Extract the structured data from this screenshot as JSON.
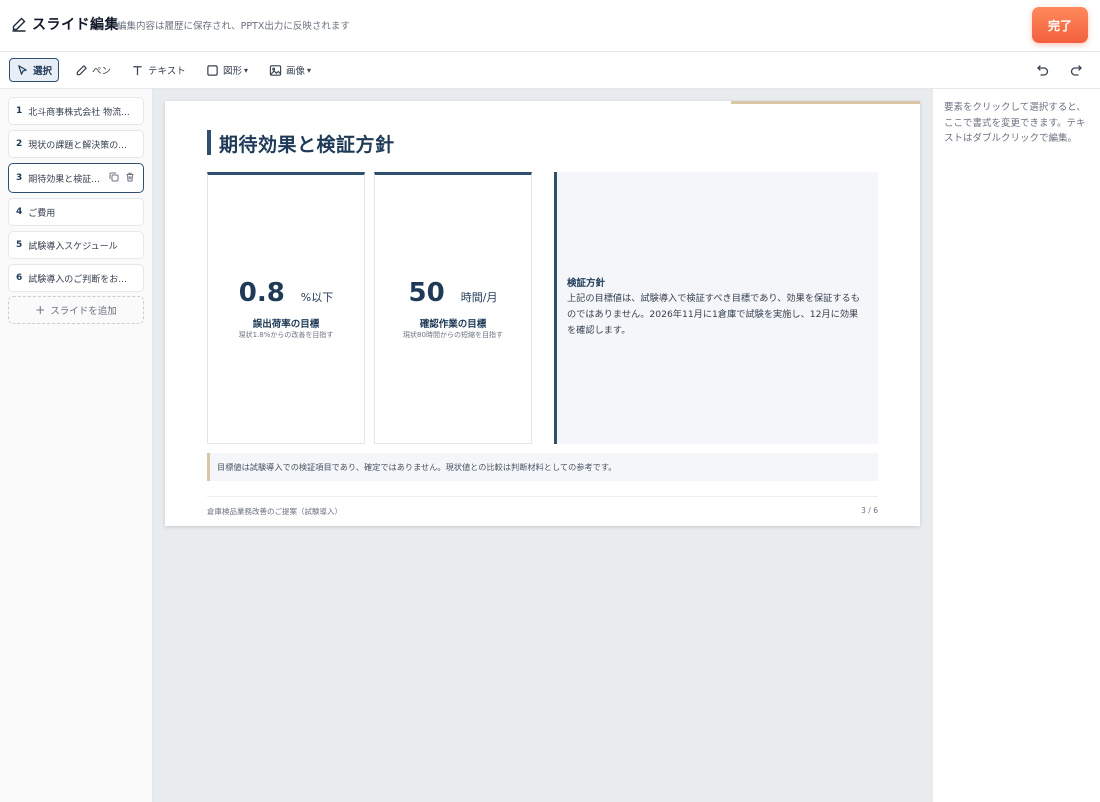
{
  "header": {
    "title": "スライド編集",
    "subtitle": "編集内容は履歴に保存され、PPTX出力に反映されます",
    "done_label": "完了"
  },
  "toolbar": {
    "tools": [
      {
        "label": "選択",
        "icon": "cursor-icon",
        "active": true
      },
      {
        "label": "ペン",
        "icon": "pen-icon"
      },
      {
        "label": "テキスト",
        "icon": "text-icon"
      },
      {
        "label": "図形",
        "icon": "shape-icon",
        "dropdown": true
      },
      {
        "label": "画像",
        "icon": "image-icon",
        "dropdown": true
      }
    ],
    "dropdown_caret": "▾"
  },
  "sidebar": {
    "slides": [
      {
        "num": "1",
        "title": "北斗商事株式会社 物流..."
      },
      {
        "num": "2",
        "title": "現状の課題と解決策の..."
      },
      {
        "num": "3",
        "title": "期待効果と検証...",
        "selected": true
      },
      {
        "num": "4",
        "title": "ご費用"
      },
      {
        "num": "5",
        "title": "試験導入スケジュール"
      },
      {
        "num": "6",
        "title": "試験導入のご判断をお..."
      }
    ],
    "add_label": "スライドを追加",
    "add_icon_glyph": "+"
  },
  "slide": {
    "heading": "期待効果と検証方針",
    "kpis": [
      {
        "value": "0.8",
        "unit": "%以下",
        "label": "誤出荷率の目標",
        "sub": "現状1.8%からの改善を目指す"
      },
      {
        "value": "50",
        "unit": "時間/月",
        "label": "確認作業の目標",
        "sub": "現状80時間からの短縮を目指す"
      }
    ],
    "policy": {
      "title": "検証方針",
      "body": "上記の目標値は、試験導入で検証すべき目標であり、効果を保証するものではありません。2026年11月に1倉庫で試験を実施し、12月に効果を確認します。"
    },
    "note": "目標値は試験導入での検証項目であり、確定ではありません。現状値との比較は判断材料としての参考です。",
    "footer_left": "倉庫検品業務改善のご提案（試験導入）",
    "page_indicator": "3 / 6"
  },
  "properties_panel": {
    "hint": "要素をクリックして選択すると、ここで書式を変更できます。テキストはダブルクリックで編集。"
  },
  "colors": {
    "accent_orange": "#f2603d",
    "navy": "#1f3a57",
    "gold_accent": "#d8c6a6"
  }
}
